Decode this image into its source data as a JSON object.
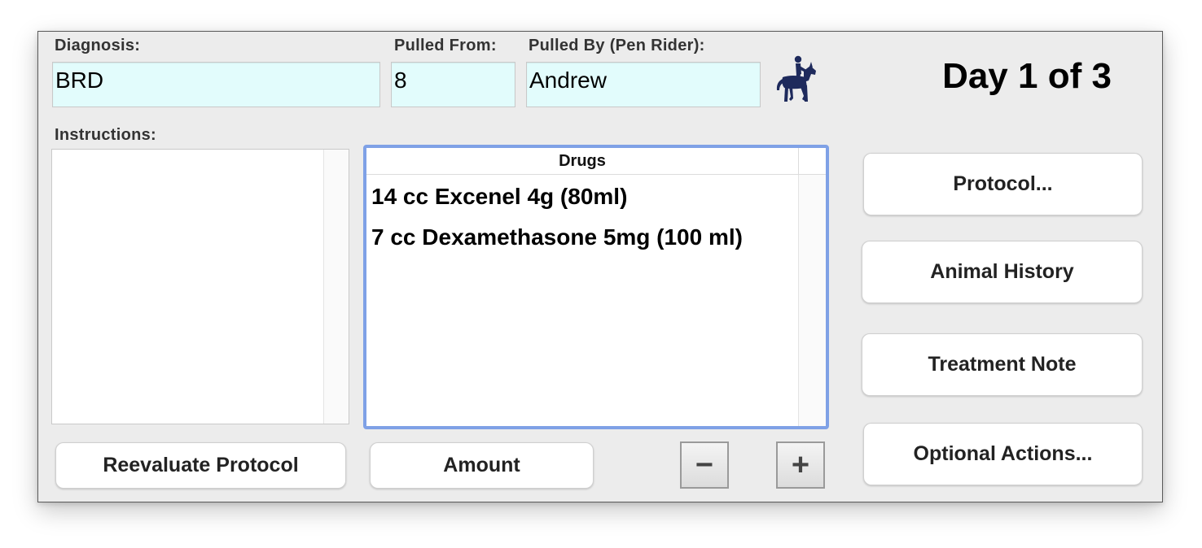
{
  "form": {
    "diagnosis_label": "Diagnosis:",
    "diagnosis_value": "BRD",
    "pulled_from_label": "Pulled From:",
    "pulled_from_value": "8",
    "pulled_by_label": "Pulled By (Pen Rider):",
    "pulled_by_value": "Andrew",
    "rider_icon": "horse-rider-icon",
    "day_label": "Day 1 of 3"
  },
  "instructions": {
    "label": "Instructions:",
    "text": ""
  },
  "drugs": {
    "header": "Drugs",
    "items": [
      "14 cc Excenel 4g (80ml)",
      "7 cc Dexamethasone 5mg (100 ml)"
    ]
  },
  "buttons": {
    "reevaluate": "Reevaluate Protocol",
    "amount": "Amount",
    "minus": "−",
    "plus": "+",
    "protocol": "Protocol...",
    "animal_history": "Animal History",
    "treatment_note": "Treatment Note",
    "optional_actions": "Optional Actions..."
  },
  "colors": {
    "field_bg": "#e2fcfc",
    "focus_ring": "#7fa1e6",
    "icon": "#1e2a5c"
  }
}
